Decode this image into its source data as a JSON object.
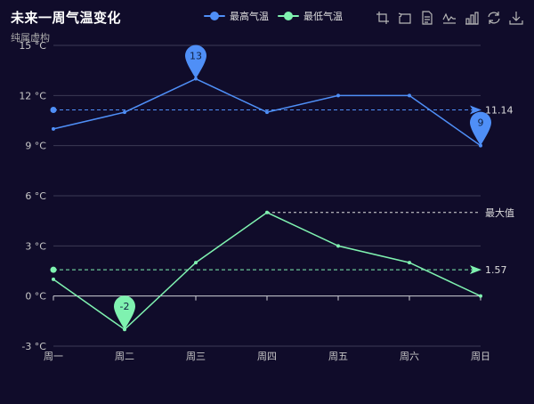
{
  "title": "未来一周气温变化",
  "subtitle": "纯属虚构",
  "legend": [
    {
      "name": "最高气温",
      "color": "#4f8ff7"
    },
    {
      "name": "最低气温",
      "color": "#7ff2b0"
    }
  ],
  "toolbox": [
    {
      "icon": "select-region-icon"
    },
    {
      "icon": "undo-zoom-icon"
    },
    {
      "icon": "data-view-icon"
    },
    {
      "icon": "line-chart-icon"
    },
    {
      "icon": "bar-chart-icon"
    },
    {
      "icon": "restore-icon"
    },
    {
      "icon": "save-image-icon"
    }
  ],
  "chart_data": {
    "type": "line",
    "title": "未来一周气温变化",
    "subtitle": "纯属虚构",
    "categories": [
      "周一",
      "周二",
      "周三",
      "周四",
      "周五",
      "周六",
      "周日"
    ],
    "y_ticks": [
      "-3 °C",
      "0 °C",
      "3 °C",
      "6 °C",
      "9 °C",
      "12 °C",
      "15 °C"
    ],
    "ylim": [
      -3,
      15
    ],
    "legend_position": "top-center",
    "series": [
      {
        "name": "最高气温",
        "color": "#4f8ff7",
        "values": [
          10,
          11,
          13,
          11,
          12,
          12,
          9
        ],
        "mark_points": [
          {
            "category": "周三",
            "value": 13,
            "label": "13"
          },
          {
            "category": "周日",
            "value": 9,
            "label": "9"
          }
        ],
        "mark_line": {
          "value": 11.14,
          "label": "11.14"
        }
      },
      {
        "name": "最低气温",
        "color": "#7ff2b0",
        "values": [
          1,
          -2,
          2,
          5,
          3,
          2,
          0
        ],
        "mark_points": [
          {
            "category": "周二",
            "value": -2,
            "label": "-2"
          }
        ],
        "mark_line": {
          "value": 1.57,
          "label": "1.57"
        },
        "max_line": {
          "category_from": "周四",
          "value": 5,
          "label": "最大值"
        }
      }
    ]
  }
}
